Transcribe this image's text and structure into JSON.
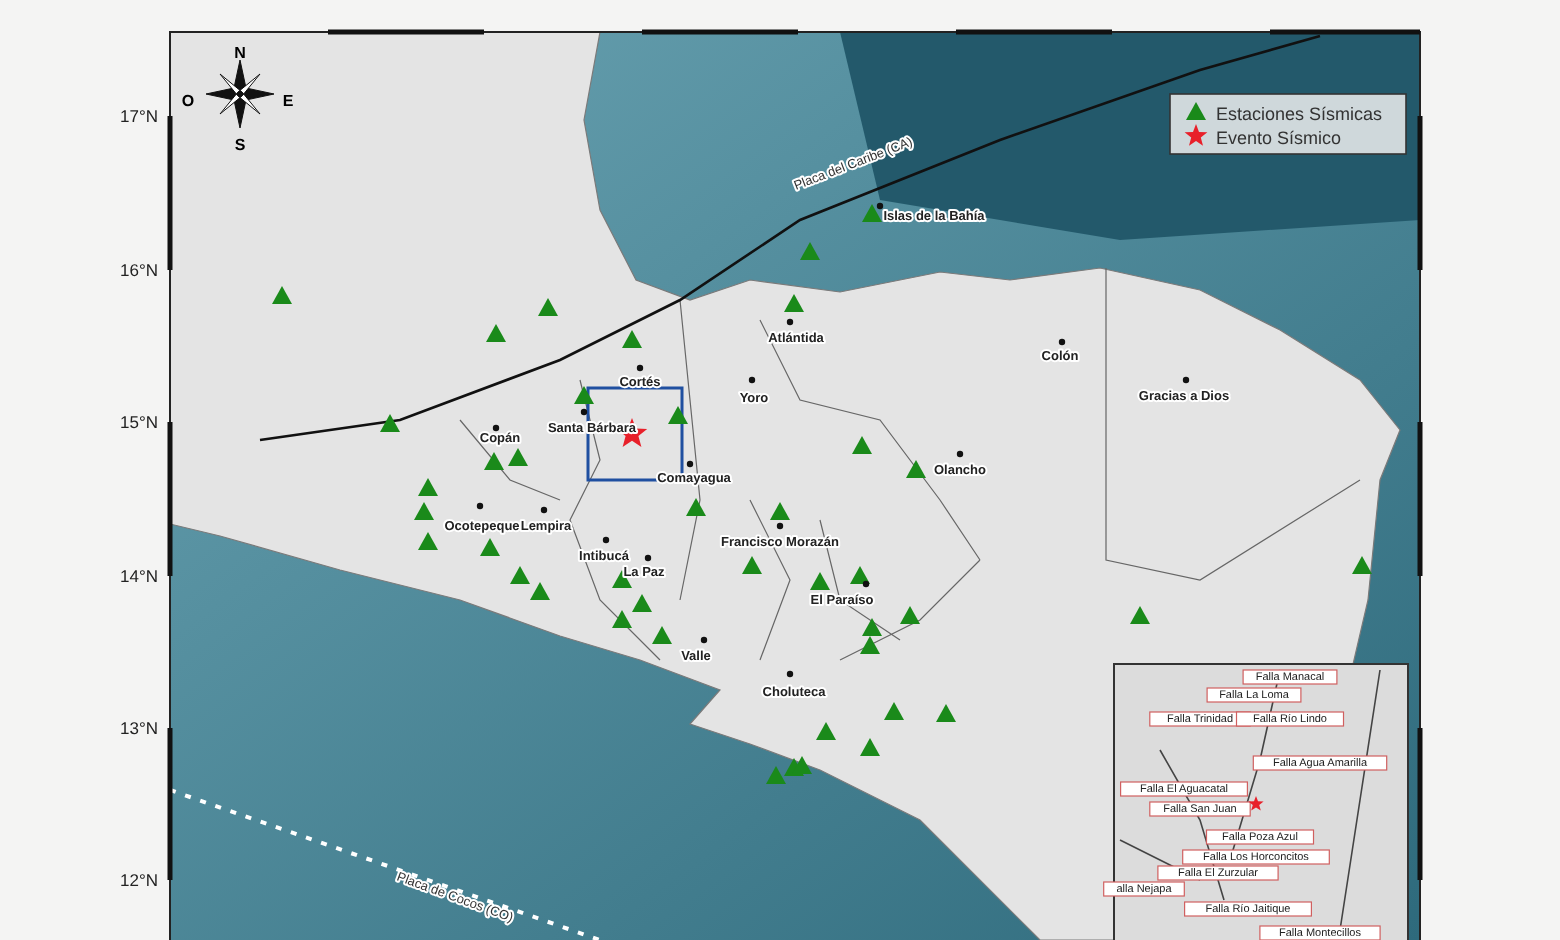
{
  "latitude_labels": [
    "17°N",
    "16°N",
    "15°N",
    "14°N",
    "13°N",
    "12°N"
  ],
  "compass": {
    "north": "N",
    "south": "S",
    "east": "E",
    "west": "O"
  },
  "legend": [
    {
      "kind": "station",
      "label": "Estaciones Sísmicas"
    },
    {
      "kind": "event",
      "label": "Evento Sísmico"
    }
  ],
  "plates": [
    "Placa del Caribe (CA)",
    "Placa de Cocos (CO)"
  ],
  "places": [
    "Islas de la Bahía",
    "Atlántida",
    "Colón",
    "Gracias a Dios",
    "Cortés",
    "Yoro",
    "Santa Bárbara",
    "Copán",
    "Comayagua",
    "Olancho",
    "Ocotepeque",
    "Lempira",
    "Francisco Morazán",
    "Intibucá",
    "La Paz",
    "El Paraíso",
    "Valle",
    "Choluteca"
  ],
  "inset_faults": [
    "Falla Manacal",
    "Falla La Loma",
    "Falla Trinidad",
    "Falla Río Lindo",
    "Falla Agua Amarilla",
    "Falla El Aguacatal",
    "Falla San Juan",
    "Falla Poza Azul",
    "Falla Los Horconcitos",
    "Falla El Zurzular",
    "alla Nejapa",
    "Falla Río Jaitique",
    "Falla Montecillos"
  ]
}
